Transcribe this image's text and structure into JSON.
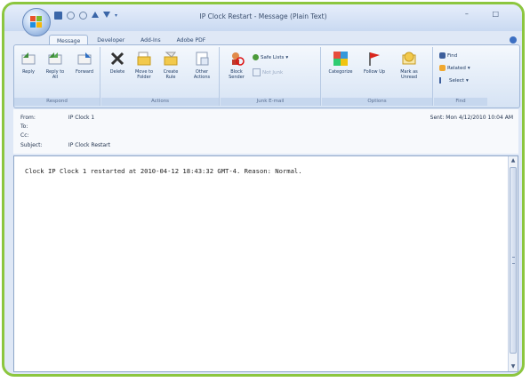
{
  "window": {
    "title": "IP Clock Restart - Message (Plain Text)",
    "controls": [
      "–",
      "□"
    ]
  },
  "quick_access": [
    "save-icon",
    "undo-icon",
    "redo-icon",
    "up-icon",
    "down-icon",
    "customize-icon"
  ],
  "tabs": [
    {
      "label": "Message",
      "active": true
    },
    {
      "label": "Developer",
      "active": false
    },
    {
      "label": "Add-Ins",
      "active": false
    },
    {
      "label": "Adobe PDF",
      "active": false
    }
  ],
  "ribbon": {
    "respond": {
      "label": "Respond",
      "reply": "Reply",
      "reply_all": "Reply to All",
      "forward": "Forward"
    },
    "actions": {
      "label": "Actions",
      "delete": "Delete",
      "move": "Move to Folder",
      "rule": "Create Rule",
      "other": "Other Actions"
    },
    "junk": {
      "label": "Junk E-mail",
      "block": "Block Sender",
      "safe_lists": "Safe Lists",
      "not_junk": "Not Junk"
    },
    "options": {
      "label": "Options",
      "categorize": "Categorize",
      "follow_up": "Follow Up",
      "mark": "Mark as Unread"
    },
    "find": {
      "label": "Find",
      "find": "Find",
      "related": "Related",
      "select": "Select"
    }
  },
  "header": {
    "from_label": "From:",
    "from_value": "IP Clock 1",
    "to_label": "To:",
    "cc_label": "Cc:",
    "subject_label": "Subject:",
    "subject_value": "IP Clock Restart",
    "sent_label": "Sent:",
    "sent_value": "Mon 4/12/2010 10:04 AM"
  },
  "message": {
    "body": "Clock IP Clock 1 restarted at 2010-04-12 18:43:32 GMT-4. Reason: Normal."
  },
  "colors": {
    "frame_border": "#8cc63f",
    "ribbon_bg": "#d6e3f4"
  }
}
